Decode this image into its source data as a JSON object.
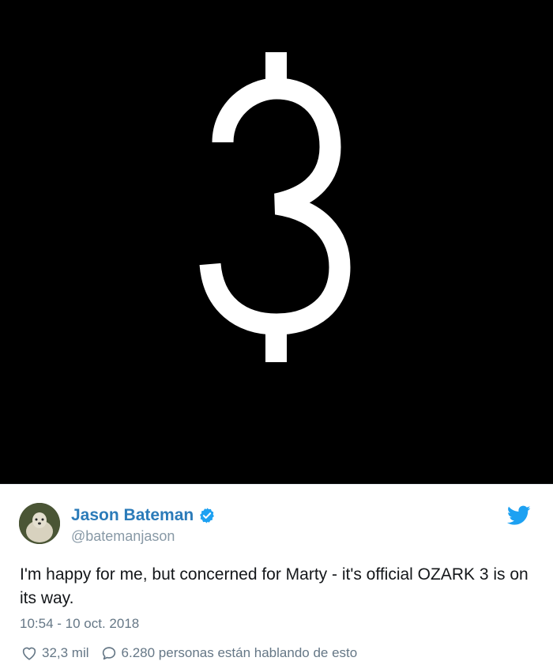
{
  "media": {
    "symbol": "3",
    "background": "#000000",
    "foreground": "#ffffff"
  },
  "tweet": {
    "author_name": "Jason Bateman",
    "author_handle": "@batemanjason",
    "verified": true,
    "text": "I'm happy for me, but concerned for Marty - it's official OZARK 3 is on its way.",
    "timestamp": "10:54 - 10 oct. 2018",
    "likes": "32,3 mil",
    "conversation": "6.280 personas están hablando de esto",
    "name_color": "#2b7bb9",
    "meta_color": "#657786"
  },
  "icons": {
    "verified": "verified-badge-icon",
    "brand": "twitter-bird-icon",
    "like": "heart-icon",
    "reply": "speech-bubble-icon"
  }
}
